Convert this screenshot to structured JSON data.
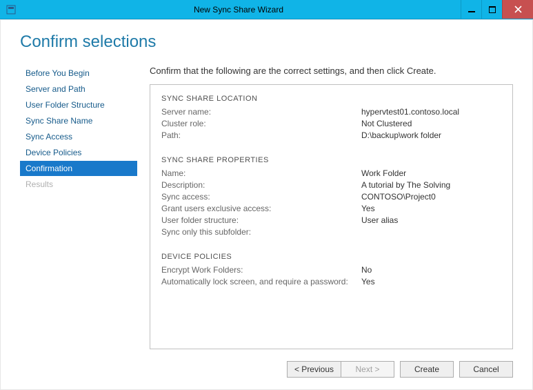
{
  "window": {
    "title": "New Sync Share Wizard"
  },
  "page": {
    "title": "Confirm selections",
    "instruction": "Confirm that the following are the correct settings, and then click Create."
  },
  "nav": {
    "items": [
      {
        "label": "Before You Begin"
      },
      {
        "label": "Server and Path"
      },
      {
        "label": "User Folder Structure"
      },
      {
        "label": "Sync Share Name"
      },
      {
        "label": "Sync Access"
      },
      {
        "label": "Device Policies"
      },
      {
        "label": "Confirmation"
      },
      {
        "label": "Results"
      }
    ]
  },
  "sections": {
    "location": {
      "title": "SYNC SHARE LOCATION",
      "server_name_label": "Server name:",
      "server_name_value": "hypervtest01.contoso.local",
      "cluster_role_label": "Cluster role:",
      "cluster_role_value": "Not Clustered",
      "path_label": "Path:",
      "path_value": "D:\\backup\\work folder"
    },
    "properties": {
      "title": "SYNC SHARE PROPERTIES",
      "name_label": "Name:",
      "name_value": "Work Folder",
      "description_label": "Description:",
      "description_value": "A tutorial by The Solving",
      "sync_access_label": "Sync access:",
      "sync_access_value": "CONTOSO\\Project0",
      "grant_exclusive_label": "Grant users exclusive access:",
      "grant_exclusive_value": "Yes",
      "folder_structure_label": "User folder structure:",
      "folder_structure_value": "User alias",
      "sync_only_subfolder_label": "Sync only this subfolder:",
      "sync_only_subfolder_value": ""
    },
    "policies": {
      "title": "DEVICE POLICIES",
      "encrypt_label": "Encrypt Work Folders:",
      "encrypt_value": "No",
      "lock_label": "Automatically lock screen, and require a password:",
      "lock_value": "Yes"
    }
  },
  "buttons": {
    "previous": "< Previous",
    "next": "Next >",
    "create": "Create",
    "cancel": "Cancel"
  }
}
